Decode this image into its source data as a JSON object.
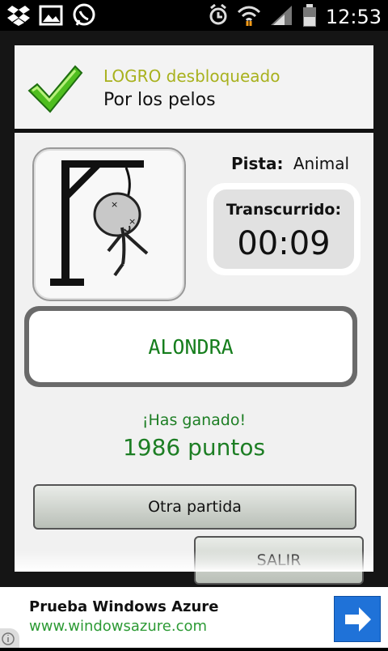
{
  "status_bar": {
    "time": "12:53",
    "left_icons": [
      "dropbox-icon",
      "image-icon",
      "whatsapp-icon"
    ],
    "right_icons": [
      "alarm-icon",
      "wifi-icon",
      "signal-icon",
      "battery-icon"
    ]
  },
  "achievement": {
    "title": "LOGRO desbloqueado",
    "name": "Por los pelos"
  },
  "game": {
    "hint_label": "Pista:",
    "hint_value": "Animal",
    "elapsed_label": "Transcurrido:",
    "elapsed_value": "00:09",
    "word": "ALONDRA",
    "result_text": "¡Has ganado!",
    "score_text": "1986 puntos"
  },
  "buttons": {
    "new_game": "Otra partida",
    "exit": "SALIR"
  },
  "ad": {
    "title": "Prueba Windows Azure",
    "url": "www.windowsazure.com"
  },
  "colors": {
    "accent_green": "#1d7e24",
    "achievement_title": "#a8b11d",
    "ad_button": "#1f72d8"
  }
}
